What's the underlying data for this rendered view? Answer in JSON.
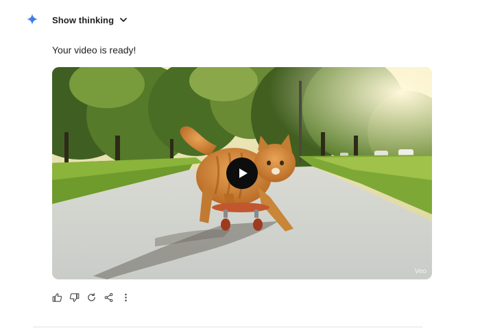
{
  "response": {
    "logo_icon": "gemini-spark-icon",
    "thinking": {
      "label": "Show thinking",
      "icon": "chevron-down-icon"
    },
    "message": "Your video is ready!",
    "video": {
      "play_icon": "play-icon",
      "watermark": "Veo"
    },
    "actions": [
      {
        "name": "thumbs-up-icon"
      },
      {
        "name": "thumbs-down-icon"
      },
      {
        "name": "regenerate-icon"
      },
      {
        "name": "share-icon"
      },
      {
        "name": "more-options-icon"
      }
    ]
  },
  "colors": {
    "gemini_blue": "#4285f4",
    "text": "#1f1f1f",
    "icon": "#444746"
  }
}
